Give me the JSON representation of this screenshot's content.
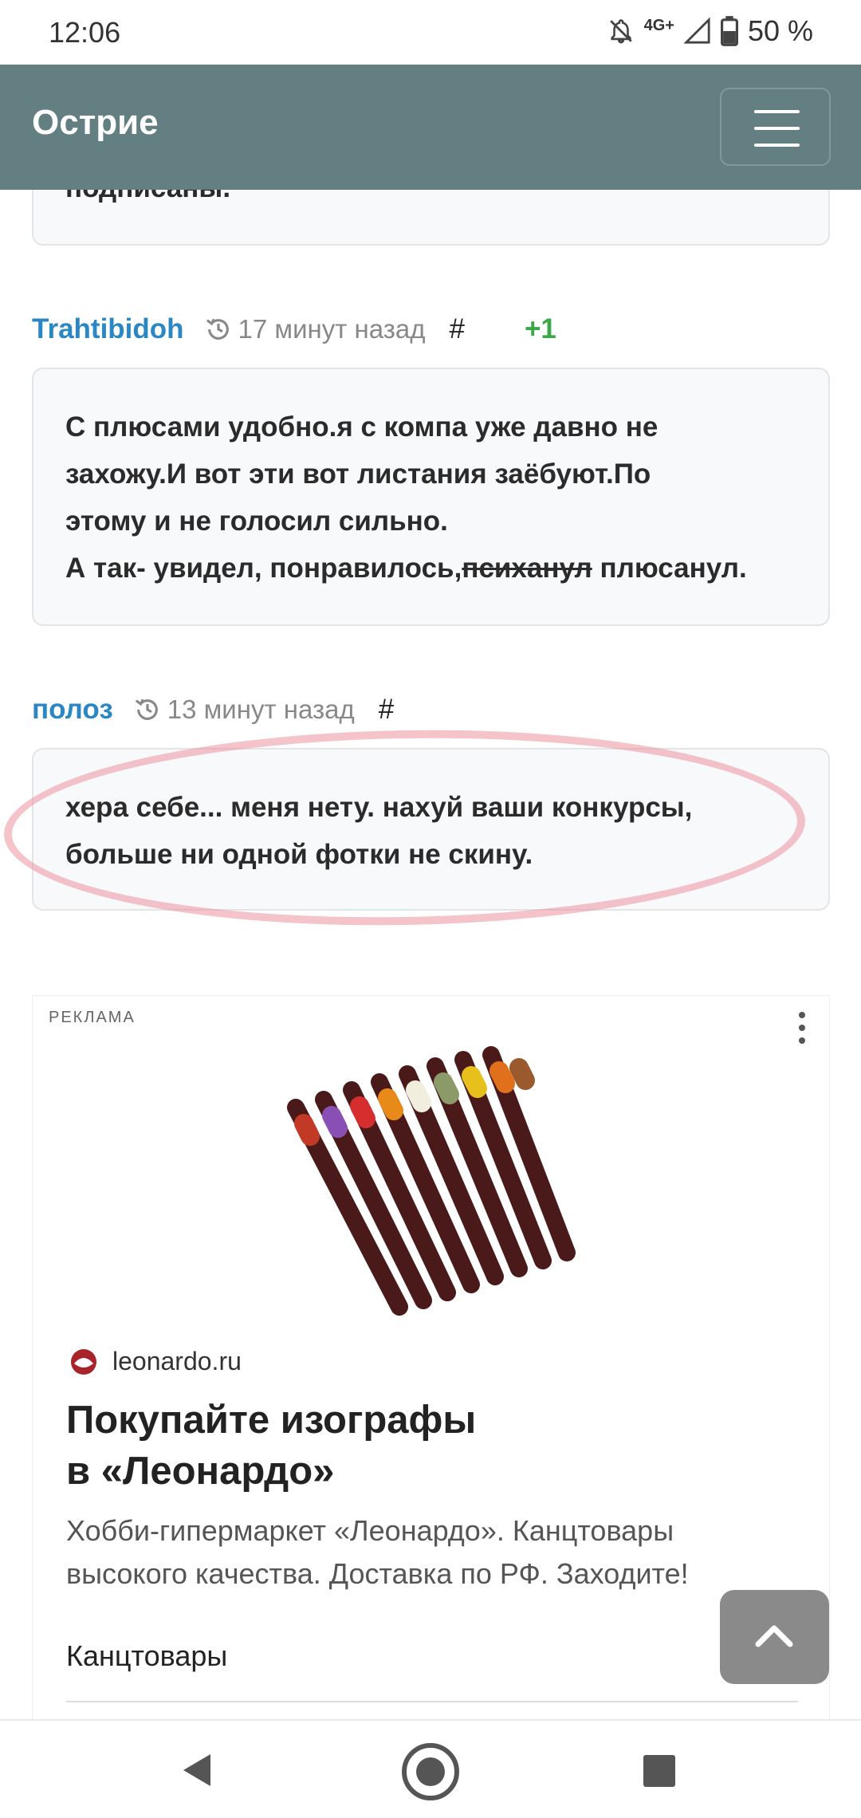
{
  "status_bar": {
    "time": "12:06",
    "network": "4G+",
    "battery": "50 %"
  },
  "header": {
    "title": "Острие"
  },
  "previous_comment": {
    "tail_text": "подписаны."
  },
  "comments": [
    {
      "author": "Trahtibidoh",
      "time": "17 минут назад",
      "anchor": "#",
      "rating": "+1",
      "lines": [
        "С плюсами удобно.я с компа уже давно не",
        "захожу.И вот эти вот листания заёбуют.По",
        "этому и не голосил сильно."
      ],
      "last_line_prefix": "А так- увидел, понравилось,",
      "last_line_strike": "психанул",
      "last_line_suffix": " плюсанул."
    },
    {
      "author": "полоз",
      "time": "13 минут назад",
      "anchor": "#",
      "lines": [
        "хера себе... меня нету. нахуй ваши конкурсы,",
        "больше ни одной фотки не скину."
      ]
    }
  ],
  "ad": {
    "label": "РЕКЛАМА",
    "domain": "leonardo.ru",
    "title_line1": "Покупайте изографы",
    "title_line2": "в «Леонардо»",
    "description_line1": "Хобби-гипермаркет «Леонардо». Канцтовары",
    "description_line2": "высокого качества. Доставка по РФ. Заходите!",
    "link": "Канцтовары"
  },
  "colors": {
    "header_bg": "#637f82",
    "author": "#2b86c4",
    "rating_positive": "#3aa847",
    "highlight_circle": "#ec929e"
  }
}
